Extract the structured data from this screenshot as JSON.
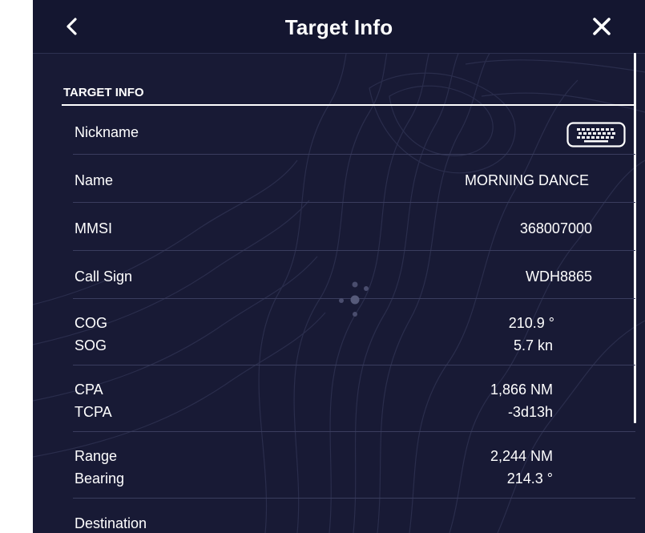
{
  "header": {
    "title": "Target Info"
  },
  "section": {
    "title": "TARGET INFO"
  },
  "rows": [
    {
      "label": "Nickname"
    },
    {
      "label": "Name",
      "value": "MORNING DANCE"
    },
    {
      "label": "MMSI",
      "value": "368007000"
    },
    {
      "label": "Call Sign",
      "value": "WDH8865"
    },
    {
      "label": "COG",
      "value": "210.9 °",
      "label2": "SOG",
      "value2": "5.7 kn"
    },
    {
      "label": "CPA",
      "value": "1,866 NM",
      "label2": "TCPA",
      "value2": "-3d13h"
    },
    {
      "label": "Range",
      "value": "2,244 NM",
      "label2": "Bearing",
      "value2": "214.3 °"
    },
    {
      "label": "Destination"
    }
  ],
  "icons": {
    "back": "chevron-left-icon",
    "close": "close-icon",
    "keyboard": "keyboard-icon",
    "loading": "loading-spinner-icon"
  },
  "colors": {
    "background": "#181a35",
    "text": "#ffffff",
    "divider": "#3a3d5e"
  }
}
